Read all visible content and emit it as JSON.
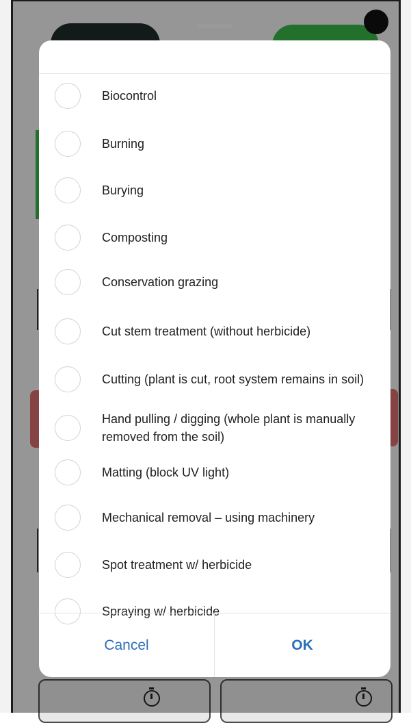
{
  "dialog": {
    "options": [
      {
        "label": "Biocontrol",
        "selected": false
      },
      {
        "label": "Burning",
        "selected": false
      },
      {
        "label": "Burying",
        "selected": false
      },
      {
        "label": "Composting",
        "selected": false
      },
      {
        "label": "Conservation grazing",
        "selected": false
      },
      {
        "label": "Cut stem treatment (without herbicide)",
        "selected": false
      },
      {
        "label": "Cutting (plant is cut, root system remains in soil)",
        "selected": false
      },
      {
        "label": "Hand pulling / digging (whole plant is manually removed from the soil)",
        "selected": false
      },
      {
        "label": "Matting (block UV light)",
        "selected": false
      },
      {
        "label": "Mechanical removal – using machinery",
        "selected": false
      },
      {
        "label": "Spot treatment w/ herbicide",
        "selected": false
      },
      {
        "label": "Spraying w/ herbicide",
        "selected": false
      }
    ],
    "cancel_label": "Cancel",
    "ok_label": "OK"
  },
  "colors": {
    "button_text": "#2a6fb6",
    "green_accent": "#39b54a",
    "red_accent": "#d86c6c",
    "dark_pill": "#1f2a2b"
  },
  "icons": {
    "bottom_left": "stopwatch-icon",
    "bottom_right": "stopwatch-icon"
  }
}
